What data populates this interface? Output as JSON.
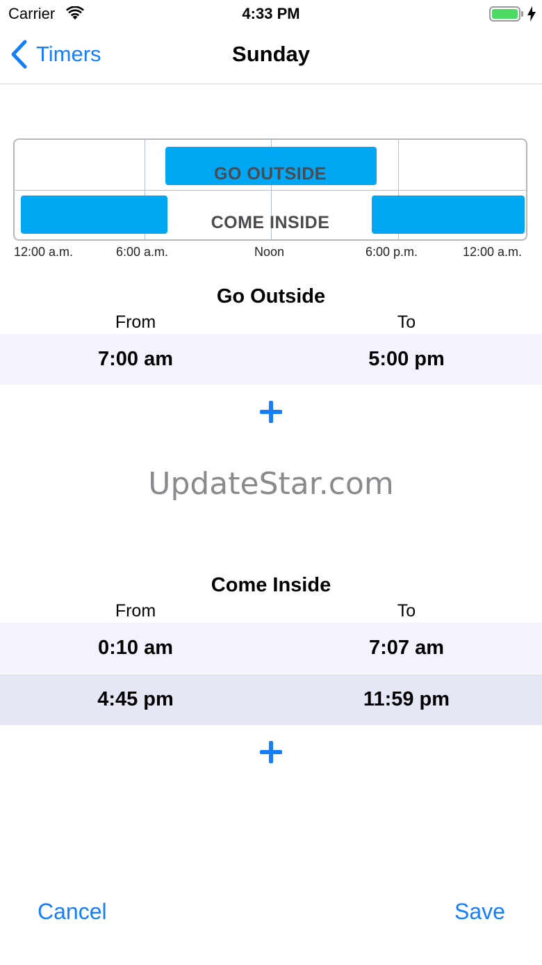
{
  "status_bar": {
    "carrier": "Carrier",
    "time": "4:33 PM",
    "icons": [
      "wifi-icon",
      "battery-icon",
      "charging-bolt-icon"
    ]
  },
  "nav": {
    "back_label": "Timers",
    "title": "Sunday"
  },
  "timeline": {
    "rows": [
      "GO OUTSIDE",
      "COME INSIDE"
    ],
    "ticks": [
      "12:00 a.m.",
      "6:00 a.m.",
      "Noon",
      "6:00 p.m.",
      "12:00 a.m."
    ],
    "block_color": "#02a7f4",
    "go_outside_ranges_hours": [
      [
        7.0,
        17.0
      ]
    ],
    "come_inside_ranges_hours": [
      [
        0.17,
        7.12
      ],
      [
        16.75,
        24.0
      ]
    ]
  },
  "go_outside": {
    "title": "Go Outside",
    "from_header": "From",
    "to_header": "To",
    "rows": [
      {
        "from": "7:00 am",
        "to": "5:00 pm"
      }
    ]
  },
  "come_inside": {
    "title": "Come Inside",
    "from_header": "From",
    "to_header": "To",
    "rows": [
      {
        "from": "0:10 am",
        "to": "7:07 am"
      },
      {
        "from": "4:45 pm",
        "to": "11:59 pm"
      }
    ]
  },
  "watermark": "UpdateStar.com",
  "toolbar": {
    "cancel_label": "Cancel",
    "save_label": "Save"
  },
  "colors": {
    "accent": "#147efb",
    "row_bg": "#f2f3fc",
    "row_bg_alt": "#e5e7f5"
  }
}
